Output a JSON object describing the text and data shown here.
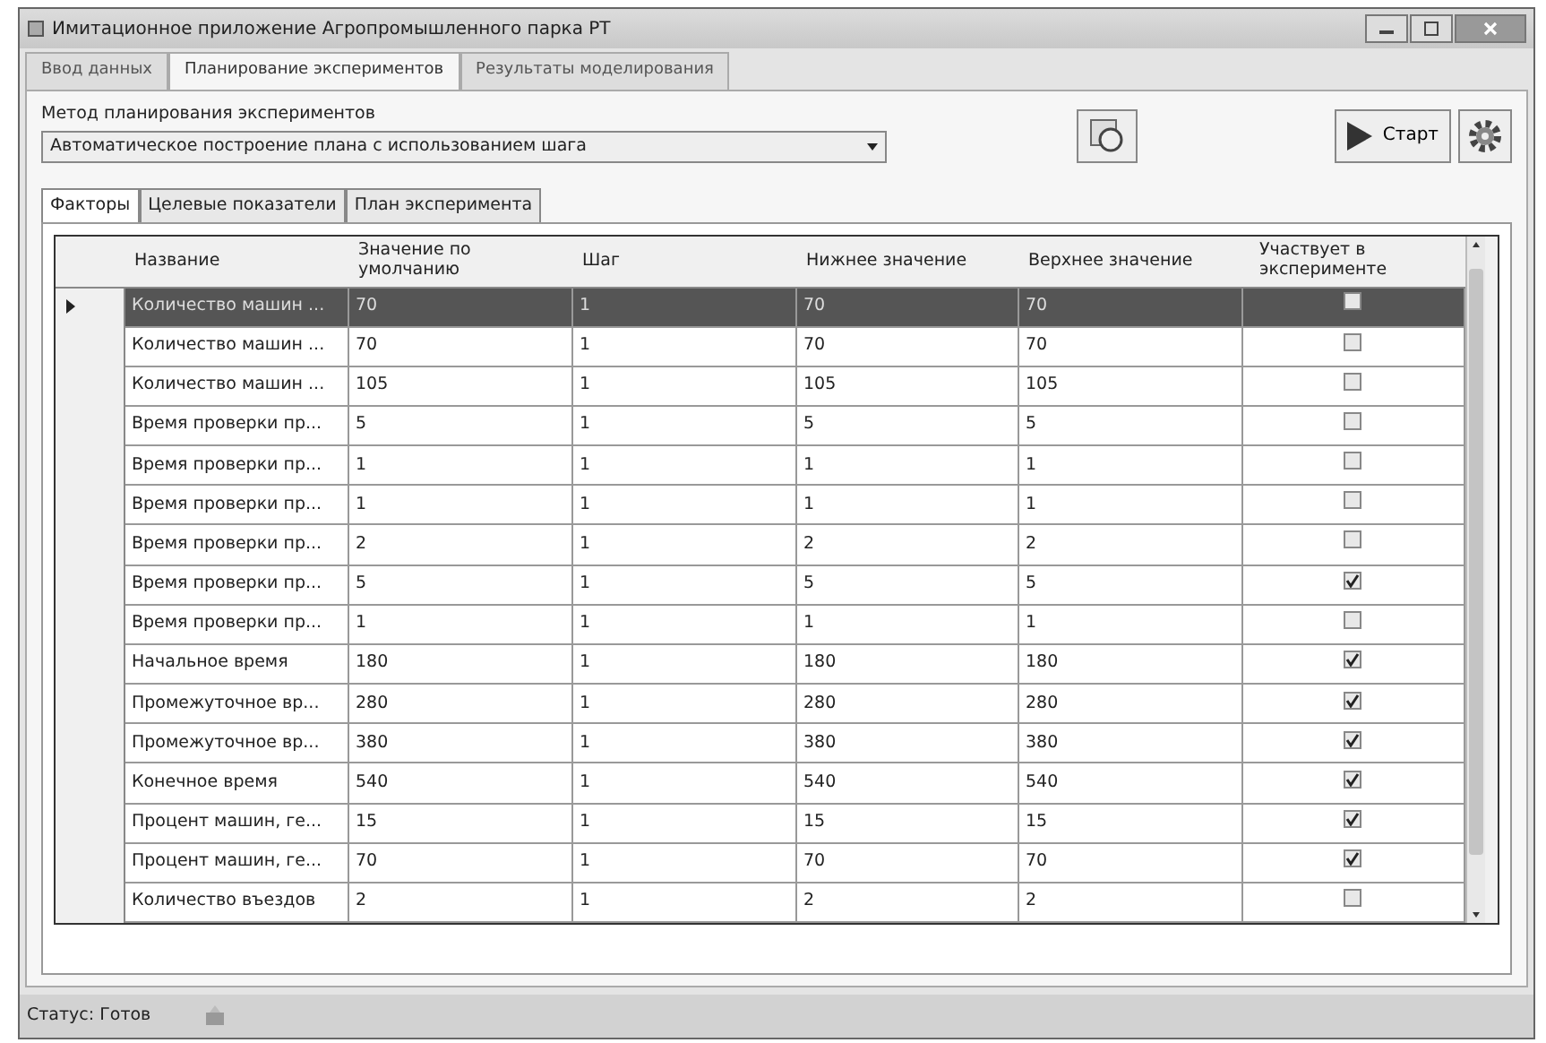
{
  "window": {
    "title": "Имитационное приложение Агропромышленного парка РТ"
  },
  "tabs": [
    {
      "label": "Ввод данных",
      "selected": false
    },
    {
      "label": "Планирование экспериментов",
      "selected": true
    },
    {
      "label": "Результаты моделирования",
      "selected": false
    }
  ],
  "method": {
    "label": "Метод планирования экспериментов",
    "value": "Автоматическое построение плана с использованием шага"
  },
  "start_button": {
    "label": "Старт"
  },
  "inner_tabs": [
    {
      "label": "Факторы",
      "selected": true
    },
    {
      "label": "Целевые показатели",
      "selected": false
    },
    {
      "label": "План эксперимента",
      "selected": false
    }
  ],
  "table": {
    "columns": [
      "Название",
      "Значение по умолчанию",
      "Шаг",
      "Нижнее значение",
      "Верхнее значение",
      "Участвует в эксперименте"
    ],
    "rows": [
      {
        "cells": [
          "Количество машин ...",
          "70",
          "1",
          "70",
          "70"
        ],
        "checked": false,
        "selected": true
      },
      {
        "cells": [
          "Количество машин ...",
          "70",
          "1",
          "70",
          "70"
        ],
        "checked": false,
        "selected": false
      },
      {
        "cells": [
          "Количество машин ...",
          "105",
          "1",
          "105",
          "105"
        ],
        "checked": false,
        "selected": false
      },
      {
        "cells": [
          "Время проверки пр...",
          "5",
          "1",
          "5",
          "5"
        ],
        "checked": false,
        "selected": false
      },
      {
        "cells": [
          "Время проверки пр...",
          "1",
          "1",
          "1",
          "1"
        ],
        "checked": false,
        "selected": false
      },
      {
        "cells": [
          "Время проверки пр...",
          "1",
          "1",
          "1",
          "1"
        ],
        "checked": false,
        "selected": false
      },
      {
        "cells": [
          "Время проверки пр...",
          "2",
          "1",
          "2",
          "2"
        ],
        "checked": false,
        "selected": false
      },
      {
        "cells": [
          "Время проверки пр...",
          "5",
          "1",
          "5",
          "5"
        ],
        "checked": true,
        "selected": false
      },
      {
        "cells": [
          "Время проверки пр...",
          "1",
          "1",
          "1",
          "1"
        ],
        "checked": false,
        "selected": false
      },
      {
        "cells": [
          "Начальное время",
          "180",
          "1",
          "180",
          "180"
        ],
        "checked": true,
        "selected": false
      },
      {
        "cells": [
          "Промежуточное вр...",
          "280",
          "1",
          "280",
          "280"
        ],
        "checked": true,
        "selected": false
      },
      {
        "cells": [
          "Промежуточное вр...",
          "380",
          "1",
          "380",
          "380"
        ],
        "checked": true,
        "selected": false
      },
      {
        "cells": [
          "Конечное время",
          "540",
          "1",
          "540",
          "540"
        ],
        "checked": true,
        "selected": false
      },
      {
        "cells": [
          "Процент машин, ге...",
          "15",
          "1",
          "15",
          "15"
        ],
        "checked": true,
        "selected": false
      },
      {
        "cells": [
          "Процент машин, ге...",
          "70",
          "1",
          "70",
          "70"
        ],
        "checked": true,
        "selected": false
      },
      {
        "cells": [
          "Количество въездов",
          "2",
          "1",
          "2",
          "2"
        ],
        "checked": false,
        "selected": false
      }
    ]
  },
  "status_bar": {
    "text": "Статус: Готов"
  }
}
